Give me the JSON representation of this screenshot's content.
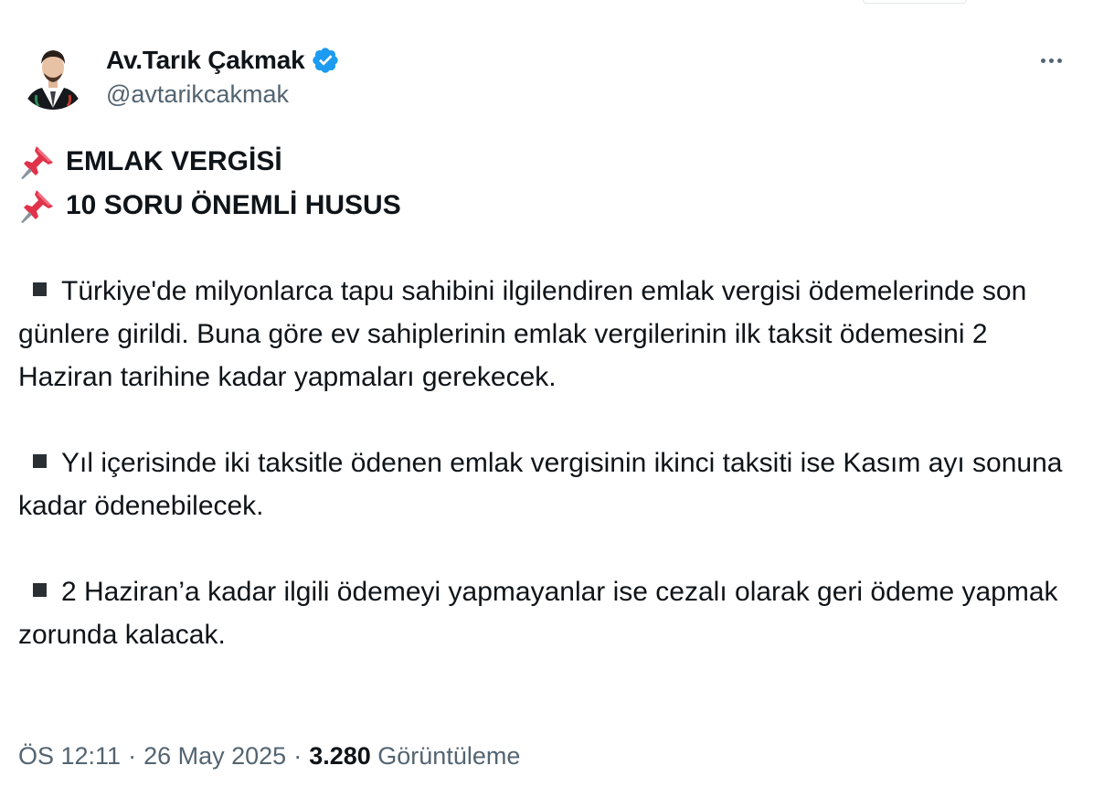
{
  "author": {
    "display_name": "Av.Tarık Çakmak",
    "handle": "@avtarikcakmak",
    "verified": true
  },
  "tweet": {
    "headlines": [
      "EMLAK VERGİSİ",
      "10 SORU ÖNEMLİ HUSUS"
    ],
    "paragraphs": [
      "Türkiye'de milyonlarca tapu sahibini ilgilendiren emlak vergisi ödemelerinde son günlere girildi. Buna göre ev sahiplerinin emlak vergilerinin ilk taksit ödemesini 2 Haziran tarihine kadar yapmaları gerekecek.",
      "Yıl içerisinde iki taksitle ödenen emlak vergisinin ikinci taksiti ise Kasım ayı sonuna kadar ödenebilecek.",
      "2 Haziran’a kadar ilgili ödemeyi yapmayanlar ise cezalı olarak geri ödeme yapmak zorunda kalacak."
    ]
  },
  "footer": {
    "time": "ÖS 12:11",
    "date": "26 May 2025",
    "separator": "·",
    "views_count": "3.280",
    "views_label": "Görüntüleme"
  },
  "icons": {
    "verified": "verified-badge-icon",
    "pin": "pushpin-icon",
    "more": "more-options-icon"
  },
  "colors": {
    "verified_blue": "#1d9bf0",
    "secondary_text": "#536471",
    "primary_text": "#0f1419"
  }
}
